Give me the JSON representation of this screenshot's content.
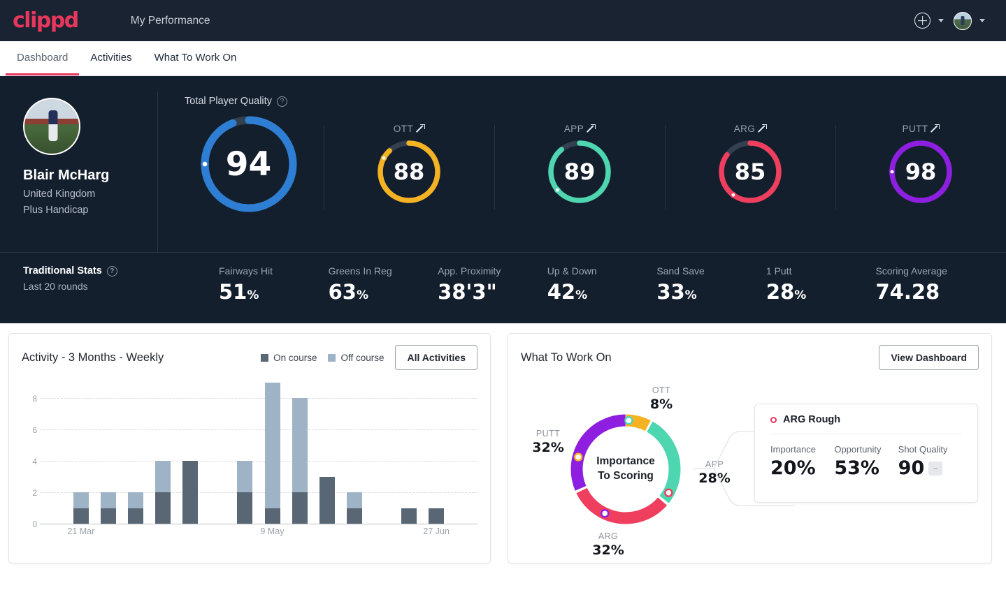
{
  "header": {
    "logo_text": "clippd",
    "nav_title": "My Performance",
    "add_icon": "plus-circle-icon",
    "add_chevron": "chevron-down-icon",
    "avatar_icon": "avatar",
    "avatar_chevron": "chevron-down-icon"
  },
  "tabs": [
    {
      "label": "Dashboard",
      "active": true
    },
    {
      "label": "Activities",
      "active": false
    },
    {
      "label": "What To Work On",
      "active": false
    }
  ],
  "profile": {
    "name": "Blair McHarg",
    "country": "United Kingdom",
    "handicap": "Plus Handicap"
  },
  "quality": {
    "section_label": "Total Player Quality",
    "help_icon": "question-mark-icon",
    "main": {
      "label": "Total Player Quality",
      "value": "94",
      "pct": 94,
      "color": "#2e7fd4"
    },
    "gauges": [
      {
        "label": "OTT",
        "value": "88",
        "pct": 88,
        "color": "#f5b324",
        "trend": "up"
      },
      {
        "label": "APP",
        "value": "89",
        "pct": 89,
        "color": "#4ed6b0",
        "trend": "up"
      },
      {
        "label": "ARG",
        "value": "85",
        "pct": 85,
        "color": "#ef3e5e",
        "trend": "up"
      },
      {
        "label": "PUTT",
        "value": "98",
        "pct": 98,
        "color": "#8e1fe0",
        "trend": "up"
      }
    ]
  },
  "traditional_stats": {
    "title": "Traditional Stats",
    "help_icon": "question-mark-icon",
    "subtitle": "Last 20 rounds",
    "items": [
      {
        "label": "Fairways Hit",
        "value": "51",
        "unit": "%"
      },
      {
        "label": "Greens In Reg",
        "value": "63",
        "unit": "%"
      },
      {
        "label": "App. Proximity",
        "value": "38'3\"",
        "unit": ""
      },
      {
        "label": "Up & Down",
        "value": "42",
        "unit": "%"
      },
      {
        "label": "Sand Save",
        "value": "33",
        "unit": "%"
      },
      {
        "label": "1 Putt",
        "value": "28",
        "unit": "%"
      },
      {
        "label": "Scoring Average",
        "value": "74.28",
        "unit": ""
      }
    ]
  },
  "activity_panel": {
    "title": "Activity - 3 Months - Weekly",
    "legend": [
      {
        "label": "On course",
        "color": "#596775"
      },
      {
        "label": "Off course",
        "color": "#9fb3c6"
      }
    ],
    "button": "All Activities"
  },
  "wtwo_panel": {
    "title": "What To Work On",
    "button": "View Dashboard",
    "center_line1": "Importance",
    "center_line2": "To Scoring",
    "detail": {
      "title": "ARG Rough",
      "marker_icon": "circle-outline-icon",
      "marker_color": "#e8365d",
      "metrics": [
        {
          "label": "Importance",
          "value": "20%"
        },
        {
          "label": "Opportunity",
          "value": "53%"
        },
        {
          "label": "Shot Quality",
          "value": "90",
          "badge": "–"
        }
      ]
    }
  },
  "chart_data": [
    {
      "type": "bar",
      "title": "Activity - 3 Months - Weekly",
      "stacked": true,
      "xlabel": "",
      "ylabel": "",
      "ylim": [
        0,
        9
      ],
      "yticks": [
        0,
        2,
        4,
        6,
        8
      ],
      "grid": true,
      "legend_position": "top-right",
      "categories": [
        "",
        "21 Mar",
        "",
        "",
        "",
        "",
        "",
        "",
        "9 May",
        "",
        "",
        "",
        "",
        "",
        "27 Jun",
        ""
      ],
      "xtick_labels": [
        {
          "index": 1,
          "label": "21 Mar"
        },
        {
          "index": 8,
          "label": "9 May"
        },
        {
          "index": 14,
          "label": "27 Jun"
        }
      ],
      "series": [
        {
          "name": "On course",
          "color": "#596775",
          "values": [
            0,
            1,
            1,
            1,
            2,
            4,
            0,
            2,
            1,
            2,
            3,
            1,
            0,
            1,
            1,
            0
          ]
        },
        {
          "name": "Off course",
          "color": "#9fb3c6",
          "values": [
            0,
            1,
            1,
            1,
            2,
            0,
            0,
            2,
            8,
            6,
            0,
            1,
            0,
            0,
            0,
            0
          ]
        }
      ],
      "totals": [
        0,
        2,
        2,
        2,
        4,
        4,
        0,
        4,
        9,
        8,
        3,
        2,
        0,
        1,
        1,
        0
      ]
    },
    {
      "type": "pie",
      "title": "Importance To Scoring",
      "donut": true,
      "labels": [
        "OTT",
        "APP",
        "ARG",
        "PUTT"
      ],
      "values": [
        8,
        28,
        32,
        32
      ],
      "value_labels": [
        "8%",
        "28%",
        "32%",
        "32%"
      ],
      "colors": [
        "#f5b324",
        "#4ed6b0",
        "#ef3e5e",
        "#8e1fe0"
      ],
      "legend_position": "around"
    }
  ]
}
